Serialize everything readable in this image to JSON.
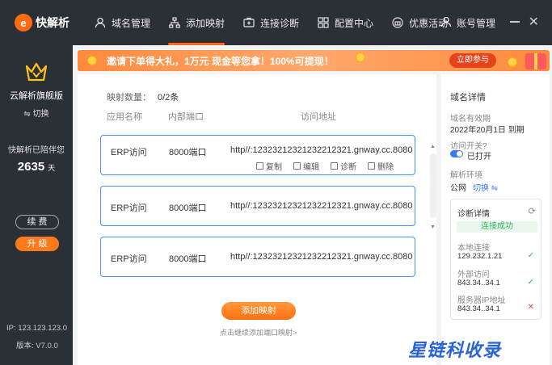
{
  "app": {
    "name": "快解析"
  },
  "nav": [
    {
      "label": "域名管理",
      "icon": "person-icon",
      "active": false
    },
    {
      "label": "添加映射",
      "icon": "sitemap-icon",
      "active": true
    },
    {
      "label": "连接诊断",
      "icon": "medkit-icon",
      "active": false
    },
    {
      "label": "配置中心",
      "icon": "grid-icon",
      "active": false
    },
    {
      "label": "优惠活动",
      "icon": "gift-circle-icon",
      "active": false
    }
  ],
  "account": {
    "label": "账号管理"
  },
  "sidebar": {
    "plan": "云解析旗舰版",
    "switch": "⇋ 切换",
    "days_label": "快解析已陪伴您",
    "days": "2635",
    "days_unit": "天",
    "renew": "续 费",
    "upgrade": "升 级",
    "ip": "IP: 123.123.123.0",
    "version": "版本: V7.0.0"
  },
  "banner": {
    "text": "邀请下单得大礼，1万元 现金等您拿！100%可提现！",
    "button": "立即参与"
  },
  "main": {
    "count_label": "映射数量：",
    "count_value": "0/2条",
    "headers": {
      "app": "应用名称",
      "port": "内部端口",
      "url": "访问地址"
    },
    "rows": [
      {
        "app": "ERP访问",
        "port": "8000端口",
        "url": "http//:12323212321232212321.gnway.cc.8080"
      },
      {
        "app": "ERP访问",
        "port": "8000端口",
        "url": "http//:12323212321232212321.gnway.cc.8080"
      },
      {
        "app": "ERP访问",
        "port": "8000端口",
        "url": "http//:12323212321232212321.gnway.cc.8080"
      }
    ],
    "actions": {
      "copy": "复制",
      "edit": "编辑",
      "diag": "诊断",
      "del": "删除"
    },
    "add_button": "添加映射",
    "hint": "点击继续添加端口映射>"
  },
  "detail": {
    "title": "域名详情",
    "expiry_label": "域名有效期",
    "expiry_value": "2022年20月1日  到期",
    "access_label": "访问开关",
    "access_state": "已打开",
    "env_label": "解析环境",
    "env_value": "公网",
    "env_switch": "切换 ⇋",
    "diag_title": "诊断详情",
    "diag_status": "连接成功",
    "local_label": "本地连接",
    "local_value": "129.232.1.21",
    "external_label": "外部访问",
    "external_value": "843.34..34.1",
    "server_label": "服务器IP地址",
    "server_value": "843.34..34.1"
  },
  "watermark": "星链科收录",
  "colors": {
    "accent": "#ff6a13",
    "link": "#3a7bf2",
    "success": "#2db55d",
    "error": "#e84a4a",
    "card_border": "#4a90f2"
  }
}
